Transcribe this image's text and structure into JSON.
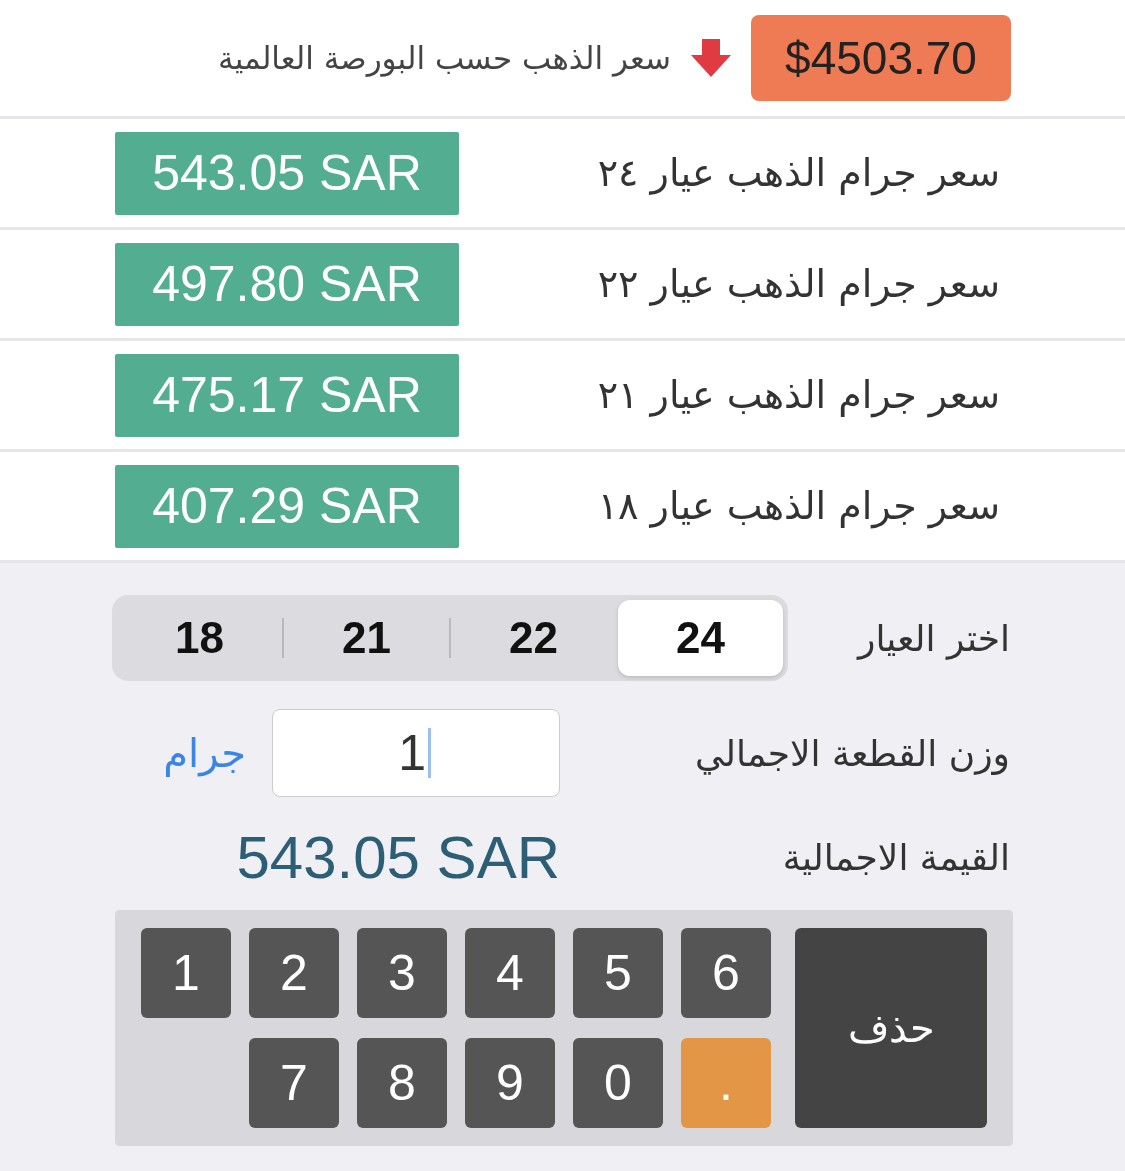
{
  "header": {
    "price": "$4503.70",
    "label": "سعر الذهب حسب البورصة العالمية"
  },
  "rows": [
    {
      "label": "سعر جرام الذهب عيار ٢٤",
      "price": "543.05 SAR"
    },
    {
      "label": "سعر جرام الذهب عيار ٢٢",
      "price": "497.80 SAR"
    },
    {
      "label": "سعر جرام الذهب عيار ٢١",
      "price": "475.17 SAR"
    },
    {
      "label": "سعر جرام الذهب عيار ١٨",
      "price": "407.29 SAR"
    }
  ],
  "karat": {
    "label": "اختر العيار",
    "options": [
      {
        "label": "24",
        "selected": true
      },
      {
        "label": "22",
        "selected": false
      },
      {
        "label": "21",
        "selected": false
      },
      {
        "label": "18",
        "selected": false
      }
    ]
  },
  "weight": {
    "label": "وزن القطعة الاجمالي",
    "value": "1",
    "unit": "جرام"
  },
  "total": {
    "label": "القيمة الاجمالية",
    "value": "543.05 SAR"
  },
  "keypad": [
    {
      "label": "حذف",
      "kind": "delete"
    },
    {
      "label": "6",
      "kind": "digit"
    },
    {
      "label": "5",
      "kind": "digit"
    },
    {
      "label": "4",
      "kind": "digit"
    },
    {
      "label": "3",
      "kind": "digit"
    },
    {
      "label": "2",
      "kind": "digit"
    },
    {
      "label": "1",
      "kind": "digit"
    },
    {
      "label": ".",
      "kind": "dot"
    },
    {
      "label": "0",
      "kind": "digit"
    },
    {
      "label": "9",
      "kind": "digit"
    },
    {
      "label": "8",
      "kind": "digit"
    },
    {
      "label": "7",
      "kind": "digit"
    }
  ]
}
